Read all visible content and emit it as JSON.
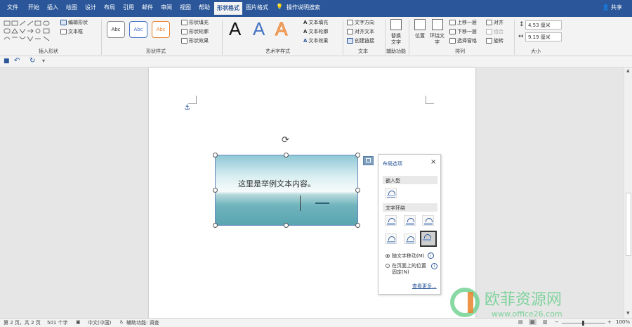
{
  "menu": {
    "tabs": [
      "文件",
      "开始",
      "插入",
      "绘图",
      "设计",
      "布局",
      "引用",
      "邮件",
      "审阅",
      "视图",
      "帮助",
      "形状格式",
      "图片格式"
    ],
    "active_tab": "形状格式",
    "search": "操作说明搜索",
    "share": "共享"
  },
  "ribbon": {
    "insert_shapes": {
      "label": "插入形状",
      "edit_shape": "编辑形状",
      "text_box": "文本框"
    },
    "shape_styles": {
      "label": "形状样式",
      "preset": "Abc",
      "fill": "形状填充",
      "outline": "形状轮廓",
      "effects": "形状效果"
    },
    "wordart": {
      "label": "艺术字样式",
      "letter": "A",
      "text_fill": "文本填充",
      "text_outline": "文本轮廓",
      "text_effects": "文本效果"
    },
    "text": {
      "label": "文本",
      "direction": "文字方向",
      "align": "对齐文本",
      "link": "创建链接"
    },
    "accessibility": {
      "label": "辅助功能",
      "alt_text_1": "替换",
      "alt_text_2": "文字"
    },
    "arrange": {
      "label": "排列",
      "position": "位置",
      "wrap_1": "环绕文",
      "wrap_2": "字",
      "forward": "上移一层",
      "backward": "下移一层",
      "selection_pane": "选择窗格",
      "align": "对齐",
      "group": "组合",
      "rotate": "旋转"
    },
    "size": {
      "label": "大小",
      "height": "4.53 厘米",
      "width": "9.19 厘米"
    }
  },
  "document": {
    "image_text": "这里是举例文本内容。"
  },
  "layout_panel": {
    "title": "布局选项",
    "inline_header": "嵌入型",
    "wrap_header": "文字环绕",
    "move_with_text": "随文字移动(M)",
    "fix_position_1": "在页面上的位置",
    "fix_position_2": "固定(N)",
    "see_more": "查看更多..."
  },
  "statusbar": {
    "page": "第 2 页，共 2 页",
    "words": "501 个字",
    "language": "中文(中国)",
    "accessibility": "辅助功能: 调查",
    "zoom": "100%"
  },
  "watermark": {
    "text": "欧菲资源网",
    "url": "www.office26.com"
  },
  "colors": {
    "brand": "#2b579a",
    "ribbon_bg": "#f3f3f3",
    "accent_orange": "#e8812a",
    "watermark_green": "#6ccf8e"
  }
}
